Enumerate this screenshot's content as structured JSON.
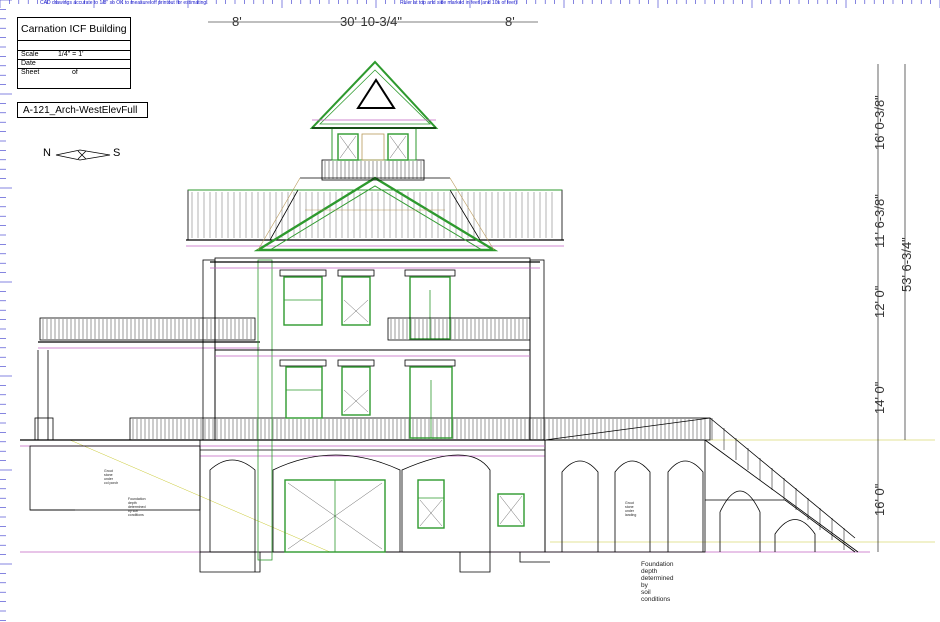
{
  "notes": {
    "cad": "CAD drawings accurate to 1/8\" so OK to measure off printout for estimating.",
    "ruler": "Ruler at top and side marked in feet (and 10s of feet)"
  },
  "title_block": {
    "title": "Carnation ICF Building",
    "scale_label": "Scale",
    "scale_value": "1/4\" = 1'",
    "date_label": "Date",
    "sheet_label": "Sheet",
    "sheet_of": "of"
  },
  "sheet_name": "A-121_Arch-WestElevFull",
  "compass": {
    "north": "N",
    "south": "S"
  },
  "dimensions": {
    "top_left": "8'",
    "top_middle": "30' 10-3/4\"",
    "top_right": "8'",
    "right_1": "16' 0-3/8\"",
    "right_2": "11' 6-3/8\"",
    "right_3": "12' 0\"",
    "right_4": "14' 0\"",
    "right_5": "16' 0\"",
    "right_total": "53' 6-3/4\""
  },
  "annotations": {
    "foundation_main": [
      "Foundation",
      "depth",
      "determined",
      "by",
      "soil",
      "conditions"
    ],
    "small_left_1": [
      "Grout",
      "stone",
      "under",
      "col porch"
    ],
    "small_left_2": [
      "Foundation",
      "depth",
      "determined",
      "by soil",
      "conditions"
    ],
    "small_right": [
      "Grout",
      "stone",
      "under",
      "landing"
    ]
  },
  "colors": {
    "green": "#2e9a2e",
    "tan": "#b8985a",
    "magenta": "#c060c0",
    "yellow": "#c8c830",
    "ruler_blue": "#3333cc"
  }
}
